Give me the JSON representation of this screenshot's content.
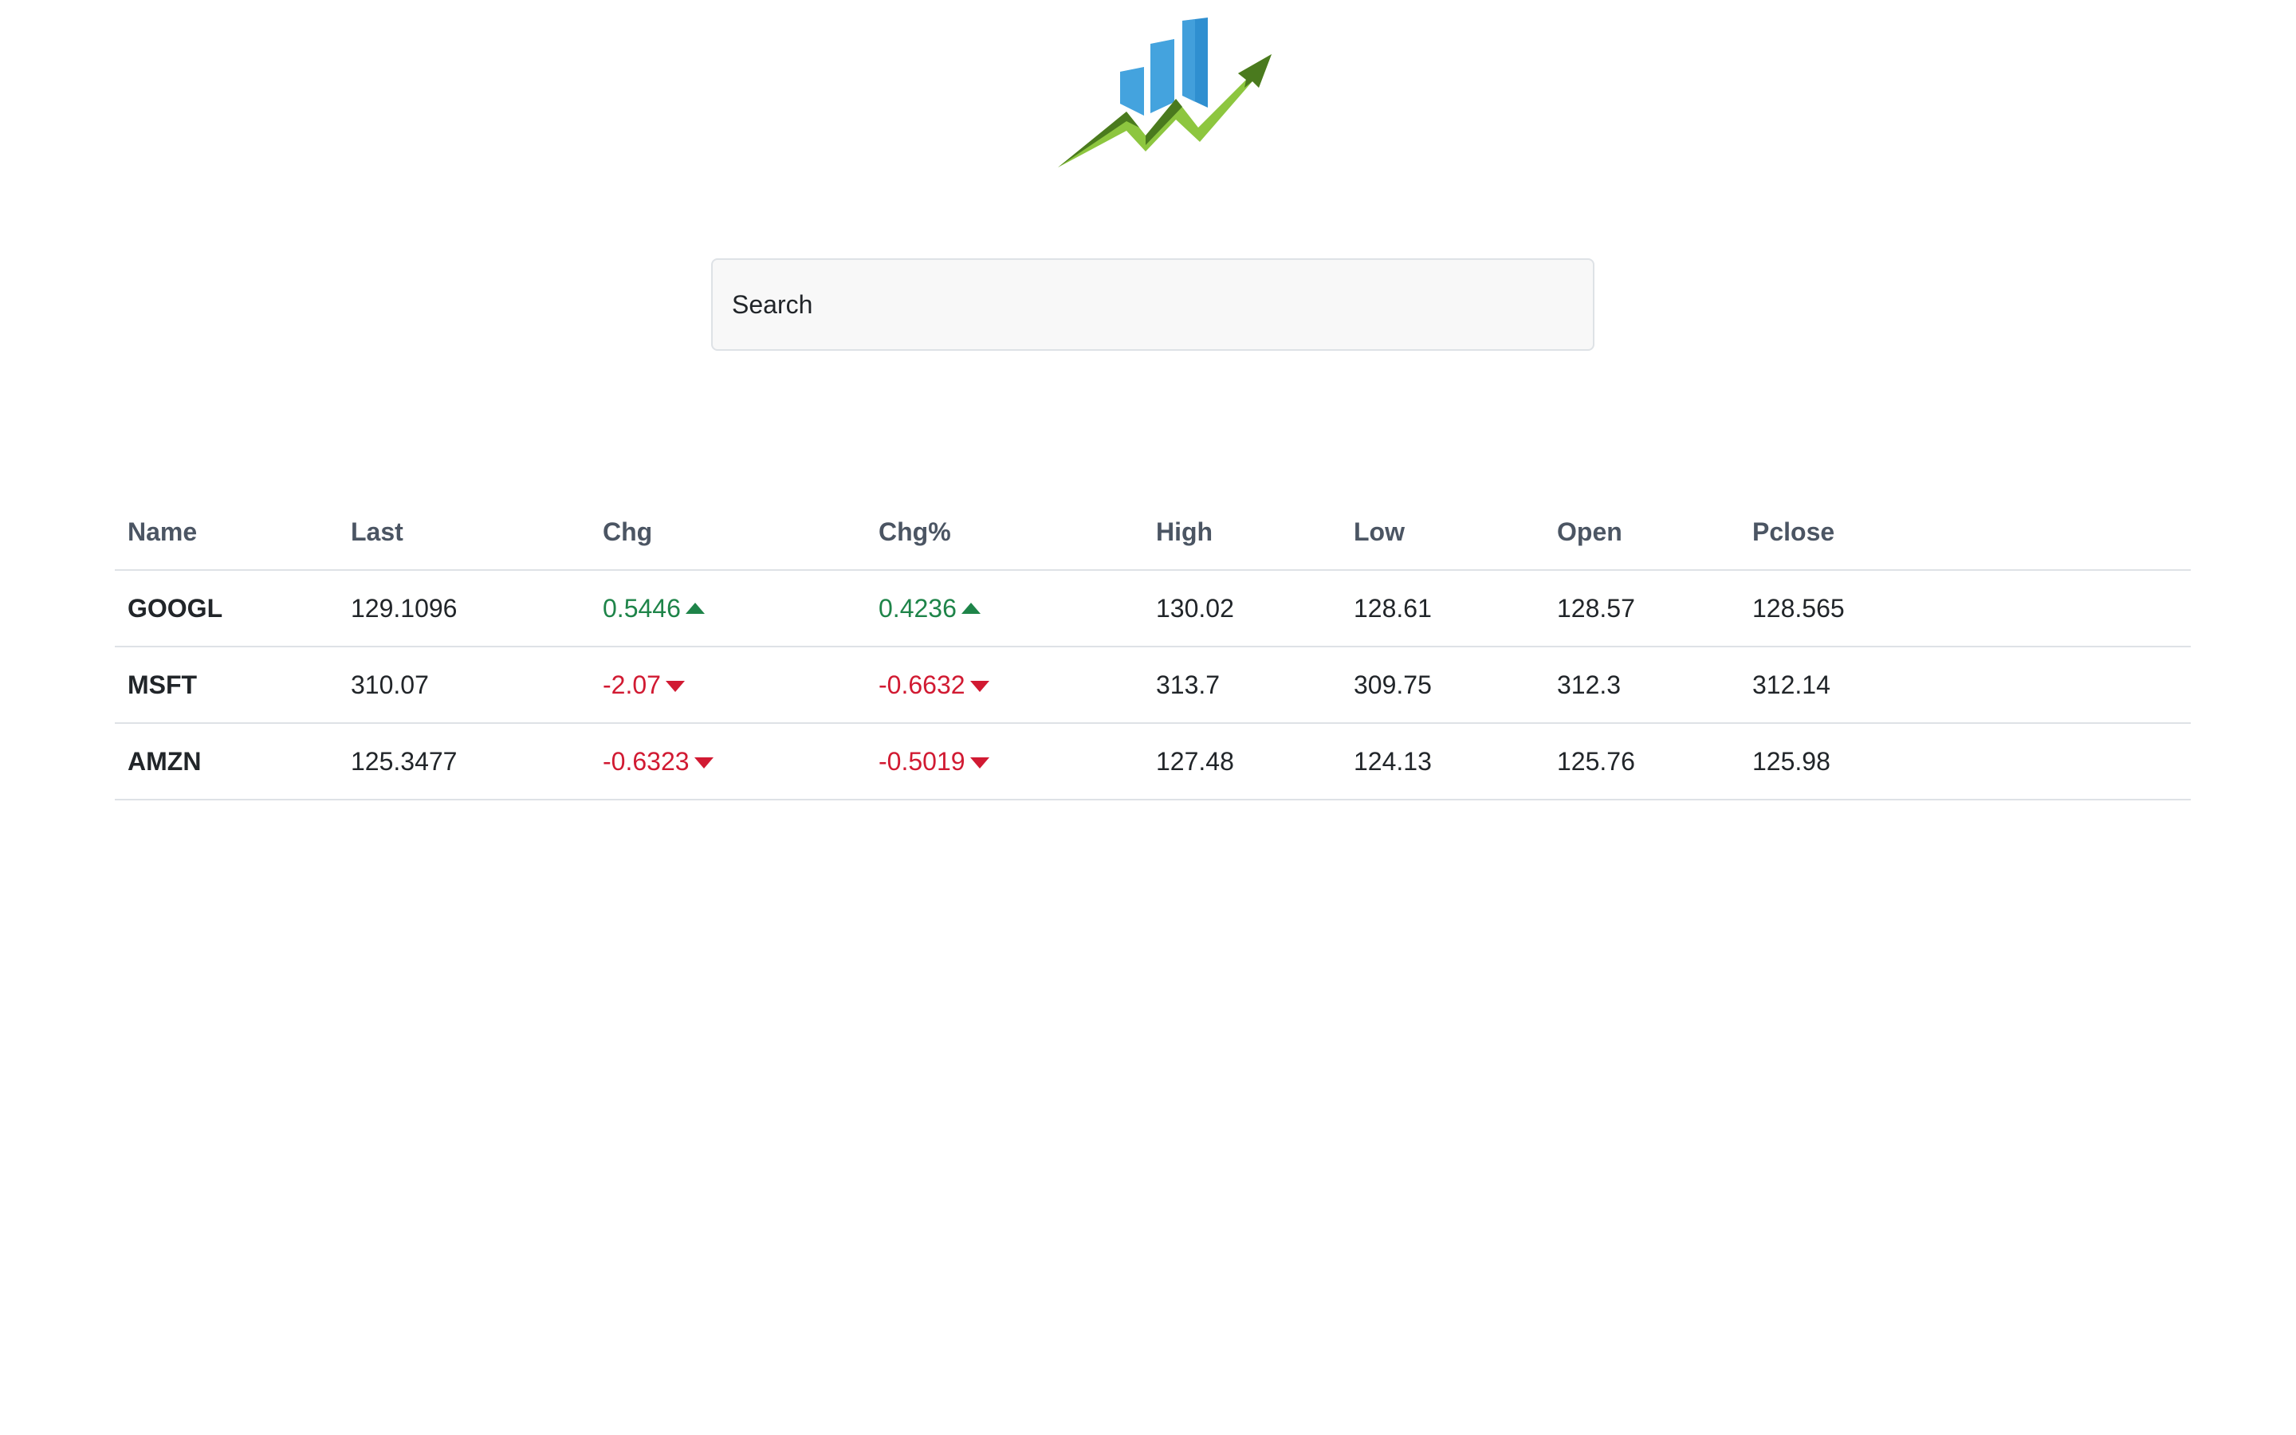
{
  "search": {
    "placeholder": "Search"
  },
  "colors": {
    "up": "#1e8449",
    "down": "#d11a32",
    "header_text": "#4b5563",
    "logo_bar_blue": "#3a9ad9",
    "logo_arrow_green": "#8dc63f",
    "logo_arrow_dark": "#4a7a1e"
  },
  "table": {
    "headers": {
      "name": "Name",
      "last": "Last",
      "chg": "Chg",
      "chgp": "Chg%",
      "high": "High",
      "low": "Low",
      "open": "Open",
      "pclose": "Pclose"
    },
    "rows": [
      {
        "name": "GOOGL",
        "last": "129.1096",
        "chg": "0.5446",
        "chgp": "0.4236",
        "high": "130.02",
        "low": "128.61",
        "open": "128.57",
        "pclose": "128.565",
        "direction": "up",
        "arrow_icon": "caret-up-icon"
      },
      {
        "name": "MSFT",
        "last": "310.07",
        "chg": "-2.07",
        "chgp": "-0.6632",
        "high": "313.7",
        "low": "309.75",
        "open": "312.3",
        "pclose": "312.14",
        "direction": "down",
        "arrow_icon": "caret-down-icon"
      },
      {
        "name": "AMZN",
        "last": "125.3477",
        "chg": "-0.6323",
        "chgp": "-0.5019",
        "high": "127.48",
        "low": "124.13",
        "open": "125.76",
        "pclose": "125.98",
        "direction": "down",
        "arrow_icon": "caret-down-icon"
      }
    ]
  }
}
